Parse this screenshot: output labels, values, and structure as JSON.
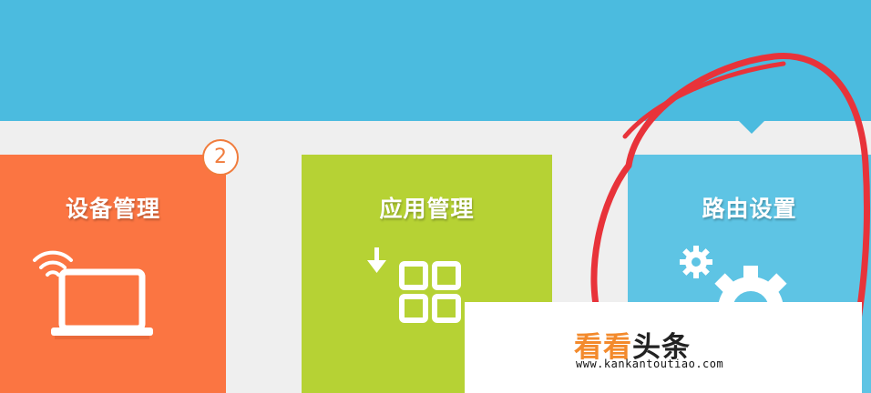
{
  "tiles": {
    "device": {
      "title": "设备管理",
      "badge": "2",
      "icon": "laptop-wifi-icon",
      "color": "#fb7542"
    },
    "apps": {
      "title": "应用管理",
      "icon": "app-grid-download-icon",
      "color": "#b6d234"
    },
    "router": {
      "title": "路由设置",
      "icon": "gears-icon",
      "color": "#5ec4e4",
      "selected": true
    }
  },
  "header": {
    "color": "#4bbbdf"
  },
  "watermark": {
    "brand_accent": "看看",
    "brand_rest": "头条",
    "url": "www.kankantoutiao.com"
  },
  "annotation": {
    "color": "#e8333a"
  }
}
